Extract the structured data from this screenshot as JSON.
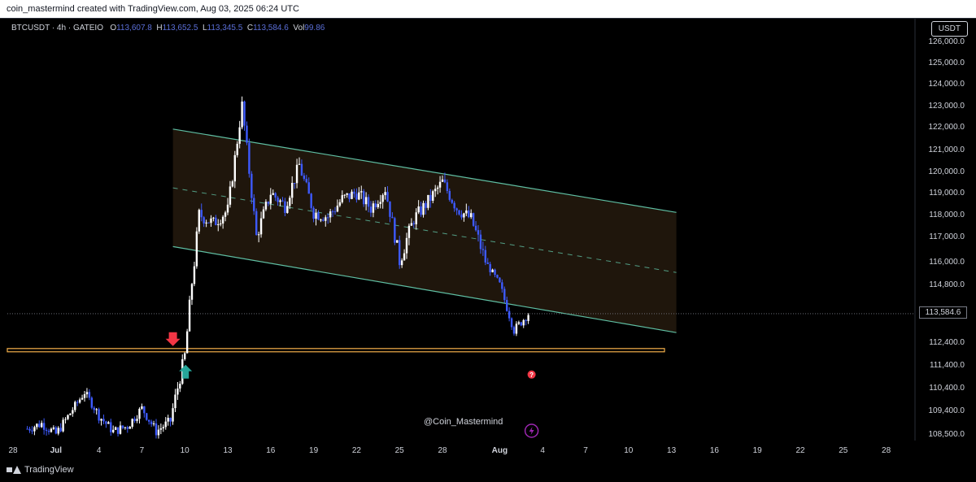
{
  "header": {
    "attribution": "coin_mastermind created with TradingView.com, Aug 03, 2025 06:24 UTC"
  },
  "legend": {
    "symbol": "BTCUSDT · 4h · GATEIO",
    "o_label": "O",
    "o_value": "113,607.8",
    "h_label": "H",
    "h_value": "113,652.5",
    "l_label": "L",
    "l_value": "113,345.5",
    "c_label": "C",
    "c_value": "113,584.6",
    "vol_label": "Vol",
    "vol_value": "99.86"
  },
  "currency_button": "USDT",
  "last_price_tag": "113,584.6",
  "watermark": "@Coin_Mastermind",
  "footer": {
    "brand": "TradingView"
  },
  "colors": {
    "background": "#000000",
    "candle_up": "#ffffff",
    "candle_down": "#3d5afe",
    "channel_fill": "#1f160c",
    "channel_line": "#5fbfa3",
    "support_line": "#f4b04a",
    "arrow_down": "#f23645",
    "arrow_up": "#26a69a",
    "question": "#f23645",
    "bolt": "#9c27b0"
  },
  "icons": {
    "down_arrow": "red-down-arrow-icon",
    "up_arrow": "teal-up-arrow-icon",
    "question": "question-mark-icon",
    "bolt": "lightning-icon",
    "logo": "tradingview-logo-icon"
  },
  "chart_data": {
    "type": "candlestick",
    "title": "",
    "xlabel": "",
    "ylabel": "",
    "x_ticks": [
      "28",
      "Jul",
      "4",
      "7",
      "10",
      "13",
      "16",
      "19",
      "22",
      "25",
      "28",
      "Aug",
      "4",
      "7",
      "10",
      "13",
      "16",
      "19",
      "22",
      "25",
      "28"
    ],
    "y_ticks": [
      "108,500.0",
      "109,400.0",
      "110,400.0",
      "111,400.0",
      "112,400.0",
      "114,800.0",
      "116,000.0",
      "117,000.0",
      "118,000.0",
      "119,000.0",
      "120,000.0",
      "121,000.0",
      "122,000.0",
      "123,000.0",
      "124,000.0",
      "125,000.0",
      "126,000.0"
    ],
    "ylim": [
      108200,
      126400
    ],
    "last_price": 113584.6,
    "channel": {
      "upper_start": 121900,
      "upper_end": 118100,
      "lower_start": 116600,
      "lower_end": 112800,
      "start_date": "Jul 9",
      "end_date": "Aug 13"
    },
    "support_level": 112050,
    "price_path": [
      [
        "Jun 29",
        108700
      ],
      [
        "Jun 30",
        108900
      ],
      [
        "Jul 1",
        108500
      ],
      [
        "Jul 2",
        109300
      ],
      [
        "Jul 3",
        110200
      ],
      [
        "Jul 4",
        109200
      ],
      [
        "Jul 5",
        108600
      ],
      [
        "Jul 6",
        108800
      ],
      [
        "Jul 7",
        109500
      ],
      [
        "Jul 8",
        108600
      ],
      [
        "Jul 9",
        109000
      ],
      [
        "Jul 10",
        111800
      ],
      [
        "Jul 11",
        118000
      ],
      [
        "Jul 12",
        117600
      ],
      [
        "Jul 13",
        118200
      ],
      [
        "Jul 14",
        123000
      ],
      [
        "Jul 15",
        117000
      ],
      [
        "Jul 16",
        119000
      ],
      [
        "Jul 17",
        118400
      ],
      [
        "Jul 18",
        120300
      ],
      [
        "Jul 19",
        118100
      ],
      [
        "Jul 20",
        117900
      ],
      [
        "Jul 21",
        118700
      ],
      [
        "Jul 22",
        119000
      ],
      [
        "Jul 23",
        118300
      ],
      [
        "Jul 24",
        119200
      ],
      [
        "Jul 25",
        116000
      ],
      [
        "Jul 26",
        117800
      ],
      [
        "Jul 27",
        118600
      ],
      [
        "Jul 28",
        119500
      ],
      [
        "Jul 29",
        118300
      ],
      [
        "Jul 30",
        117800
      ],
      [
        "Jul 31",
        116000
      ],
      [
        "Aug 1",
        114800
      ],
      [
        "Aug 2",
        112900
      ],
      [
        "Aug 3",
        113584.6
      ]
    ]
  }
}
